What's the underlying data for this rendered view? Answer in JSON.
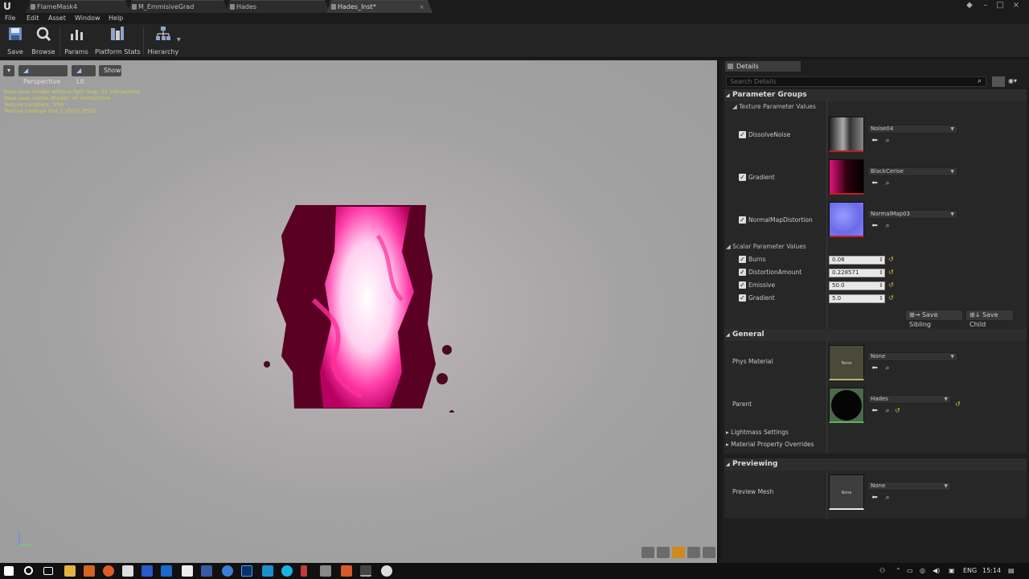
{
  "tabs": [
    {
      "label": "FlameMask4",
      "active": false
    },
    {
      "label": "M_EmmisiveGrad",
      "active": false
    },
    {
      "label": "Hades",
      "active": false
    },
    {
      "label": "Hades_Inst*",
      "active": true
    }
  ],
  "menu": [
    "File",
    "Edit",
    "Asset",
    "Window",
    "Help"
  ],
  "toolbar": {
    "save": "Save",
    "browse": "Browse",
    "params": "Params",
    "platform_stats": "Platform Stats",
    "hierarchy": "Hierarchy"
  },
  "viewport": {
    "perspective": "Perspective",
    "lit": "Lit",
    "show": "Show",
    "stats": [
      "Base pass shader without light map: 51 instructions",
      "Base pass vertex shader: 40 instructions",
      "Texture samplers: 3/16",
      "Texture Lookups (Est.): VS(0), PS(3)"
    ]
  },
  "details": {
    "tab_label": "Details",
    "search_placeholder": "Search Details",
    "parameter_groups": "Parameter Groups",
    "texture_params_header": "Texture Parameter Values",
    "texture_params": [
      {
        "name": "DissolveNoise",
        "value": "Noise04",
        "checked": true
      },
      {
        "name": "Gradient",
        "value": "BlackCerise",
        "checked": true
      },
      {
        "name": "NormalMapDistortion",
        "value": "NormalMap03",
        "checked": true
      }
    ],
    "scalar_params_header": "Scalar Parameter Values",
    "scalar_params": [
      {
        "name": "Burns",
        "value": "0.08",
        "checked": true
      },
      {
        "name": "DistortionAmount",
        "value": "0.228571",
        "checked": true
      },
      {
        "name": "Emissive",
        "value": "50.0",
        "checked": true
      },
      {
        "name": "Gradient",
        "value": "5.0",
        "checked": true
      }
    ],
    "save_sibling": "Save Sibling",
    "save_child": "Save Child",
    "general": "General",
    "phys_material_label": "Phys Material",
    "phys_material_value": "None",
    "phys_thumb_text": "None",
    "parent_label": "Parent",
    "parent_value": "Hades",
    "lightmass_settings": "Lightmass Settings",
    "material_property_overrides": "Material Property Overrides",
    "previewing": "Previewing",
    "preview_mesh_label": "Preview Mesh",
    "preview_mesh_value": "None",
    "preview_thumb_text": "None"
  },
  "taskbar": {
    "lang": "ENG",
    "time": "15:14"
  }
}
